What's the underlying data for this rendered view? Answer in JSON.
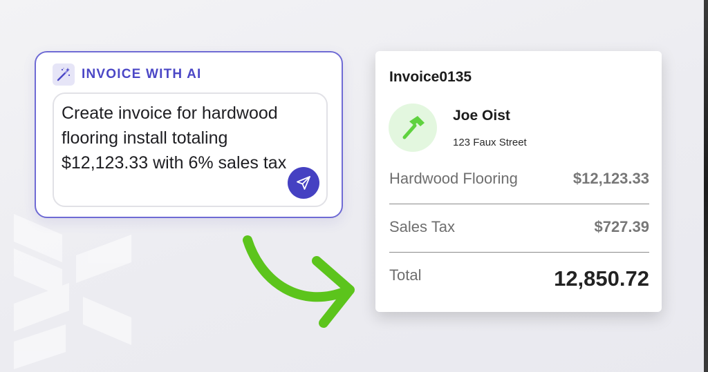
{
  "assistant": {
    "title": "INVOICE WITH AI",
    "icon": "magic-wand-icon",
    "prompt_text": "Create invoice for hardwood flooring install totaling $12,123.33 with 6% sales tax",
    "send_icon": "send-icon"
  },
  "invoice": {
    "id": "Invoice0135",
    "avatar_icon": "hammer-icon",
    "client_name": "Joe Oist",
    "client_address": "123 Faux Street",
    "line_items": [
      {
        "label": "Hardwood Flooring",
        "amount": "$12,123.33"
      },
      {
        "label": "Sales Tax",
        "amount": "$727.39"
      }
    ],
    "total_label": "Total",
    "total_value": "12,850.72"
  },
  "colors": {
    "accent": "#4b47c6",
    "card_border": "#6e6ad4",
    "send_button": "#4541c2",
    "arrow": "#5cc41c",
    "avatar_bg": "#e3f7df",
    "hammer": "#5fd23f"
  }
}
